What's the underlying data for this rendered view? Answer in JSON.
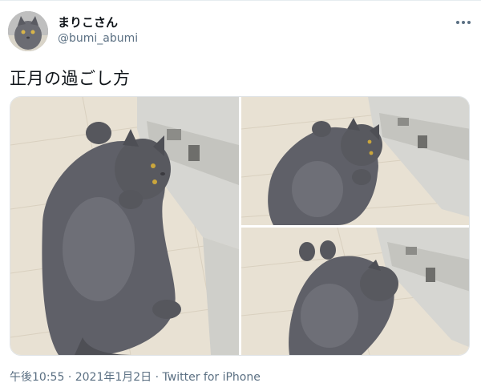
{
  "user": {
    "display_name": "まりこさん",
    "handle": "@bumi_abumi",
    "avatar_icon": "cat-avatar"
  },
  "more_icon": "more-dots-icon",
  "tweet": {
    "text": "正月の過ごし方"
  },
  "media": {
    "photo_count": 3
  },
  "meta": {
    "time": "午後10:55",
    "separator": "·",
    "date": "2021年1月2日",
    "source": "Twitter for iPhone"
  },
  "colors": {
    "text": "#0f1419",
    "secondary": "#5b7083",
    "floor": "#e9e2d4",
    "cat": "#5f6068"
  }
}
